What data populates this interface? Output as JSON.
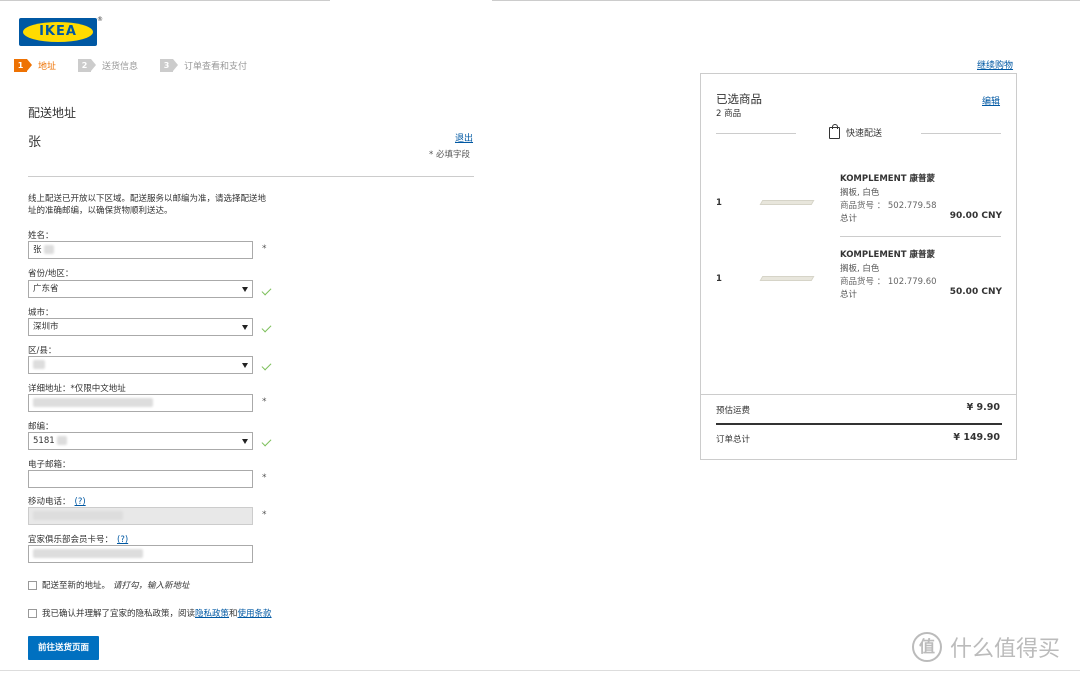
{
  "logo": {
    "text": "IKEA",
    "reg": "®"
  },
  "steps": [
    {
      "num": "1",
      "label": "地址",
      "active": true
    },
    {
      "num": "2",
      "label": "送货信息",
      "active": false
    },
    {
      "num": "3",
      "label": "订单查看和支付",
      "active": false
    }
  ],
  "shipping": {
    "heading": "配送地址",
    "username": "张",
    "logout": "退出",
    "required_note": "* 必填字段",
    "intro": "线上配送已开放以下区域。配送服务以邮编为准，请选择配送地址的准确邮编，以确保货物顺利送达。"
  },
  "form": {
    "name_label": "姓名：",
    "name_value": "张",
    "province_label": "省份/地区：",
    "province_value": "广东省",
    "city_label": "城市：",
    "city_value": "深圳市",
    "district_label": "区/县：",
    "district_value": "",
    "address_label": "详细地址：*仅限中文地址",
    "zip_label": "邮编：",
    "zip_value": "5181",
    "email_label": "电子邮箱：",
    "email_value": "",
    "mobile_label": "移动电话：",
    "mobile_help": "(?)",
    "member_label": "宜家俱乐部会员卡号：",
    "member_help": "(?)",
    "required_mark": "*"
  },
  "options": {
    "new_address_label": "配送至新的地址。",
    "new_address_hint": "请打勾，输入新地址",
    "privacy_prefix": "我已确认并理解了宜家的隐私政策，阅读",
    "privacy_link": "隐私政策",
    "privacy_and": "和",
    "terms_link": "使用条款"
  },
  "next_button": "前往送货页面",
  "continue_shopping": "继续购物",
  "cart": {
    "title": "已选商品",
    "count": "2 商品",
    "edit": "编辑",
    "delivery": "快速配送",
    "items": [
      {
        "qty": "1",
        "name": "KOMPLEMENT 康普蒙",
        "desc": "搁板, 白色",
        "art": "商品货号 ： 502.779.58",
        "total_label": "总计",
        "total": "90.00 CNY"
      },
      {
        "qty": "1",
        "name": "KOMPLEMENT 康普蒙",
        "desc": "搁板, 白色",
        "art": "商品货号 ： 102.779.60",
        "total_label": "总计",
        "total": "50.00 CNY"
      }
    ],
    "shipping_label": "预估运费",
    "shipping_value": "¥ 9.90",
    "order_total_label": "订单总计",
    "order_total_value": "¥ 149.90"
  },
  "watermark": {
    "icon": "值",
    "text": "什么值得买"
  }
}
